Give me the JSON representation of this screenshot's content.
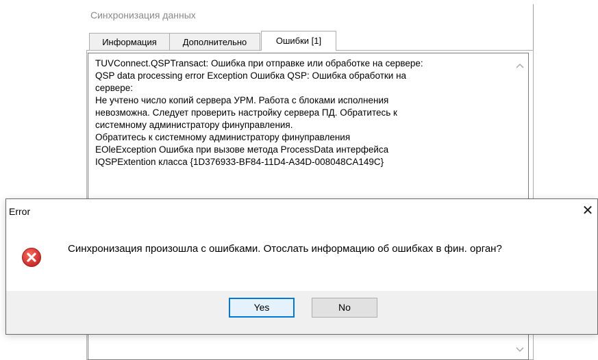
{
  "sync_window": {
    "title": "Синхронизация данных",
    "tabs": [
      {
        "label": "Информация",
        "active": false
      },
      {
        "label": "Дополнительно",
        "active": false
      },
      {
        "label": "Ошибки [1]",
        "active": true
      }
    ],
    "error_log": [
      "TUVConnect.QSPTransact: Ошибка при отправке или обработке на сервере:",
      "QSP data processing error Exception Ошибка QSP: Ошибка обработки на",
      "сервере:",
      "Не учтено число копий сервера УРМ. Работа с блоками исполнения",
      "невозможна. Следует проверить настройку сервера ПД. Обратитесь к",
      "системному администратору финуправления.",
      "Обратитесь к системному администратору финуправления",
      "EOleException Ошибка при вызове метода ProcessData интерфейса",
      "IQSPExtention класса {1D376933-BF84-11D4-A34D-008048CA149C}"
    ],
    "scroll_up_icon": "chevron-up-icon",
    "scroll_down_icon": "chevron-down-icon"
  },
  "dialog": {
    "title": "Error",
    "close_glyph": "✕",
    "icon": "error-icon",
    "message": "Синхронизация произошла с ошибками. Отослать информацию об ошибках в фин. орган?",
    "buttons": {
      "yes": "Yes",
      "no": "No"
    }
  },
  "colors": {
    "error_icon_red": "#d32f2f",
    "accent_focus": "#0078d7",
    "footer_bg": "#f0f0f0"
  }
}
